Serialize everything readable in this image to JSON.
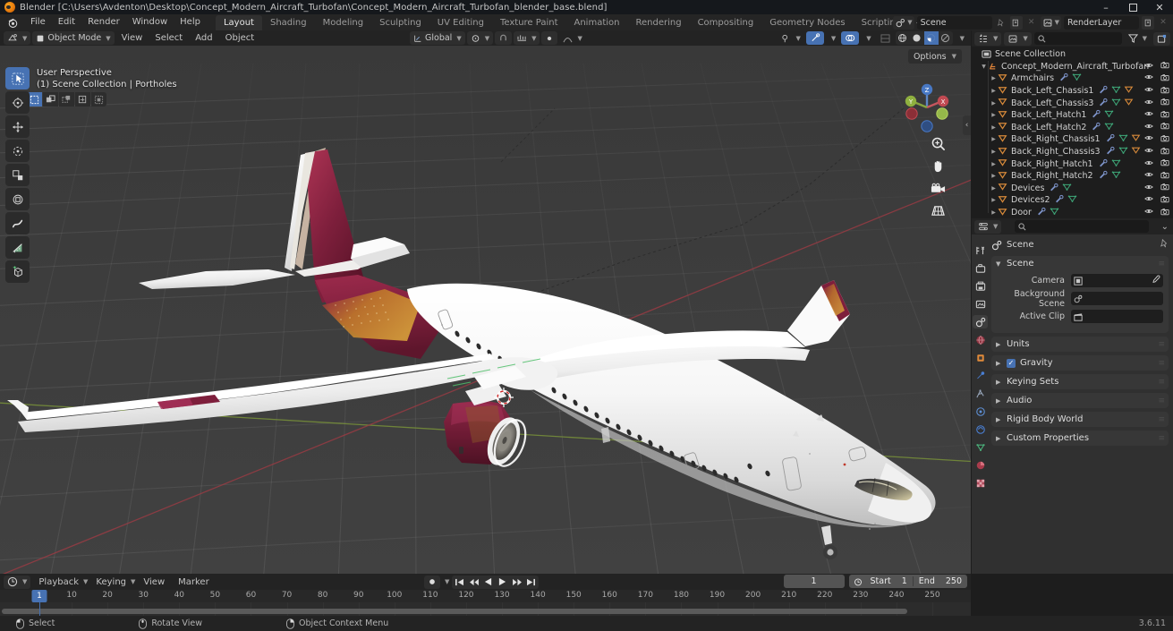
{
  "window": {
    "title": "Blender [C:\\Users\\Avdenton\\Desktop\\Concept_Modern_Aircraft_Turbofan\\Concept_Modern_Aircraft_Turbofan_blender_base.blend]",
    "minimize": "–",
    "maximize": "❐",
    "close": "✕"
  },
  "topbar": {
    "menus": [
      "File",
      "Edit",
      "Render",
      "Window",
      "Help"
    ],
    "tabs": [
      {
        "label": "Layout",
        "active": true
      },
      {
        "label": "Shading",
        "active": false
      },
      {
        "label": "Modeling",
        "active": false
      },
      {
        "label": "Sculpting",
        "active": false
      },
      {
        "label": "UV Editing",
        "active": false
      },
      {
        "label": "Texture Paint",
        "active": false
      },
      {
        "label": "Animation",
        "active": false
      },
      {
        "label": "Rendering",
        "active": false
      },
      {
        "label": "Compositing",
        "active": false
      },
      {
        "label": "Geometry Nodes",
        "active": false
      },
      {
        "label": "Scripting",
        "active": false
      }
    ],
    "add_tab": "+",
    "scene_name": "Scene",
    "viewlayer_name": "RenderLayer"
  },
  "viewport_header": {
    "mode": "Object Mode",
    "menus": [
      "View",
      "Select",
      "Add",
      "Object"
    ],
    "transform_orientation": "Global"
  },
  "viewport": {
    "overlay_line1": "User Perspective",
    "overlay_line2": "(1) Scene Collection | Portholes",
    "options_label": "Options",
    "gizmo_axes": [
      "X",
      "Y",
      "Z"
    ],
    "tools": [
      "tweak-select-tool",
      "cursor-tool",
      "move-tool",
      "rotate-tool",
      "scale-tool",
      "transform-tool",
      "annotate-tool",
      "measure-tool",
      "add-cube-tool"
    ],
    "nav_tools": [
      "zoom-tool",
      "pan-tool",
      "camera-view-tool",
      "toggle-perspective-tool"
    ]
  },
  "outliner": {
    "root": "Scene Collection",
    "collection": "Concept_Modern_Aircraft_Turbofan",
    "objects": [
      {
        "name": "Armchairs",
        "mods": [
          "modifier",
          "mesh"
        ]
      },
      {
        "name": "Back_Left_Chassis1",
        "mods": [
          "modifier",
          "mesh",
          "material-orange"
        ]
      },
      {
        "name": "Back_Left_Chassis3",
        "mods": [
          "modifier",
          "mesh",
          "material-orange"
        ]
      },
      {
        "name": "Back_Left_Hatch1",
        "mods": [
          "modifier",
          "mesh"
        ]
      },
      {
        "name": "Back_Left_Hatch2",
        "mods": [
          "modifier",
          "mesh"
        ]
      },
      {
        "name": "Back_Right_Chassis1",
        "mods": [
          "modifier",
          "mesh",
          "material-orange"
        ]
      },
      {
        "name": "Back_Right_Chassis3",
        "mods": [
          "modifier",
          "mesh",
          "material-orange"
        ]
      },
      {
        "name": "Back_Right_Hatch1",
        "mods": [
          "modifier",
          "mesh"
        ]
      },
      {
        "name": "Back_Right_Hatch2",
        "mods": [
          "modifier",
          "mesh"
        ]
      },
      {
        "name": "Devices",
        "mods": [
          "modifier",
          "mesh"
        ]
      },
      {
        "name": "Devices2",
        "mods": [
          "modifier",
          "mesh"
        ]
      },
      {
        "name": "Door",
        "mods": [
          "modifier",
          "mesh"
        ]
      }
    ]
  },
  "properties": {
    "breadcrumb": "Scene",
    "panels": [
      {
        "title": "Scene",
        "open": true,
        "rows": [
          {
            "label": "Camera",
            "value": "",
            "icon": "camera-icon",
            "eyedropper": true
          },
          {
            "label": "Background Scene",
            "value": "",
            "icon": "scene-icon",
            "eyedropper": false
          },
          {
            "label": "Active Clip",
            "value": "",
            "icon": "clapperboard-icon",
            "eyedropper": false
          }
        ]
      },
      {
        "title": "Units",
        "open": false,
        "rows": []
      },
      {
        "title": "Gravity",
        "open": false,
        "checkbox": true,
        "checked": true,
        "rows": []
      },
      {
        "title": "Keying Sets",
        "open": false,
        "rows": []
      },
      {
        "title": "Audio",
        "open": false,
        "rows": []
      },
      {
        "title": "Rigid Body World",
        "open": false,
        "rows": []
      },
      {
        "title": "Custom Properties",
        "open": false,
        "rows": []
      }
    ],
    "tabs": [
      "tool-tab",
      "render-tab",
      "output-tab",
      "view-layer-tab",
      "scene-tab",
      "world-tab",
      "object-tab",
      "modifier-tab",
      "particles-tab",
      "physics-tab",
      "constraints-tab",
      "object-data-tab",
      "material-tab",
      "texture-tab"
    ],
    "active_tab_index": 4
  },
  "timeline": {
    "menus": [
      "Playback",
      "Keying",
      "View",
      "Marker"
    ],
    "current_frame": "1",
    "start_label": "Start",
    "start_value": "1",
    "end_label": "End",
    "end_value": "250",
    "playhead_label": "1",
    "ticks": [
      10,
      20,
      30,
      40,
      50,
      60,
      70,
      80,
      90,
      100,
      110,
      120,
      130,
      140,
      150,
      160,
      170,
      180,
      190,
      200,
      210,
      220,
      230,
      240,
      250
    ],
    "transport": [
      "jump-start",
      "prev-keyframe",
      "play-reverse",
      "play",
      "next-keyframe",
      "jump-end"
    ]
  },
  "statusbar": {
    "items": [
      {
        "mouse": "left",
        "label": "Select"
      },
      {
        "mouse": "middle",
        "label": "Rotate View"
      },
      {
        "mouse": "right",
        "label": "Object Context Menu"
      }
    ],
    "version": "3.6.11"
  },
  "colors": {
    "accent_blue": "#4772b3",
    "livery_maroon": "#7a1f3d",
    "livery_gold": "#c8862a",
    "fuselage_white": "#f2f2f2",
    "viewport_bg": "#3b3b3b",
    "axis_x_red": "#9c3b44",
    "axis_y_green": "#7f9c3b",
    "header_bg": "#232323",
    "panel_bg": "#303030"
  }
}
